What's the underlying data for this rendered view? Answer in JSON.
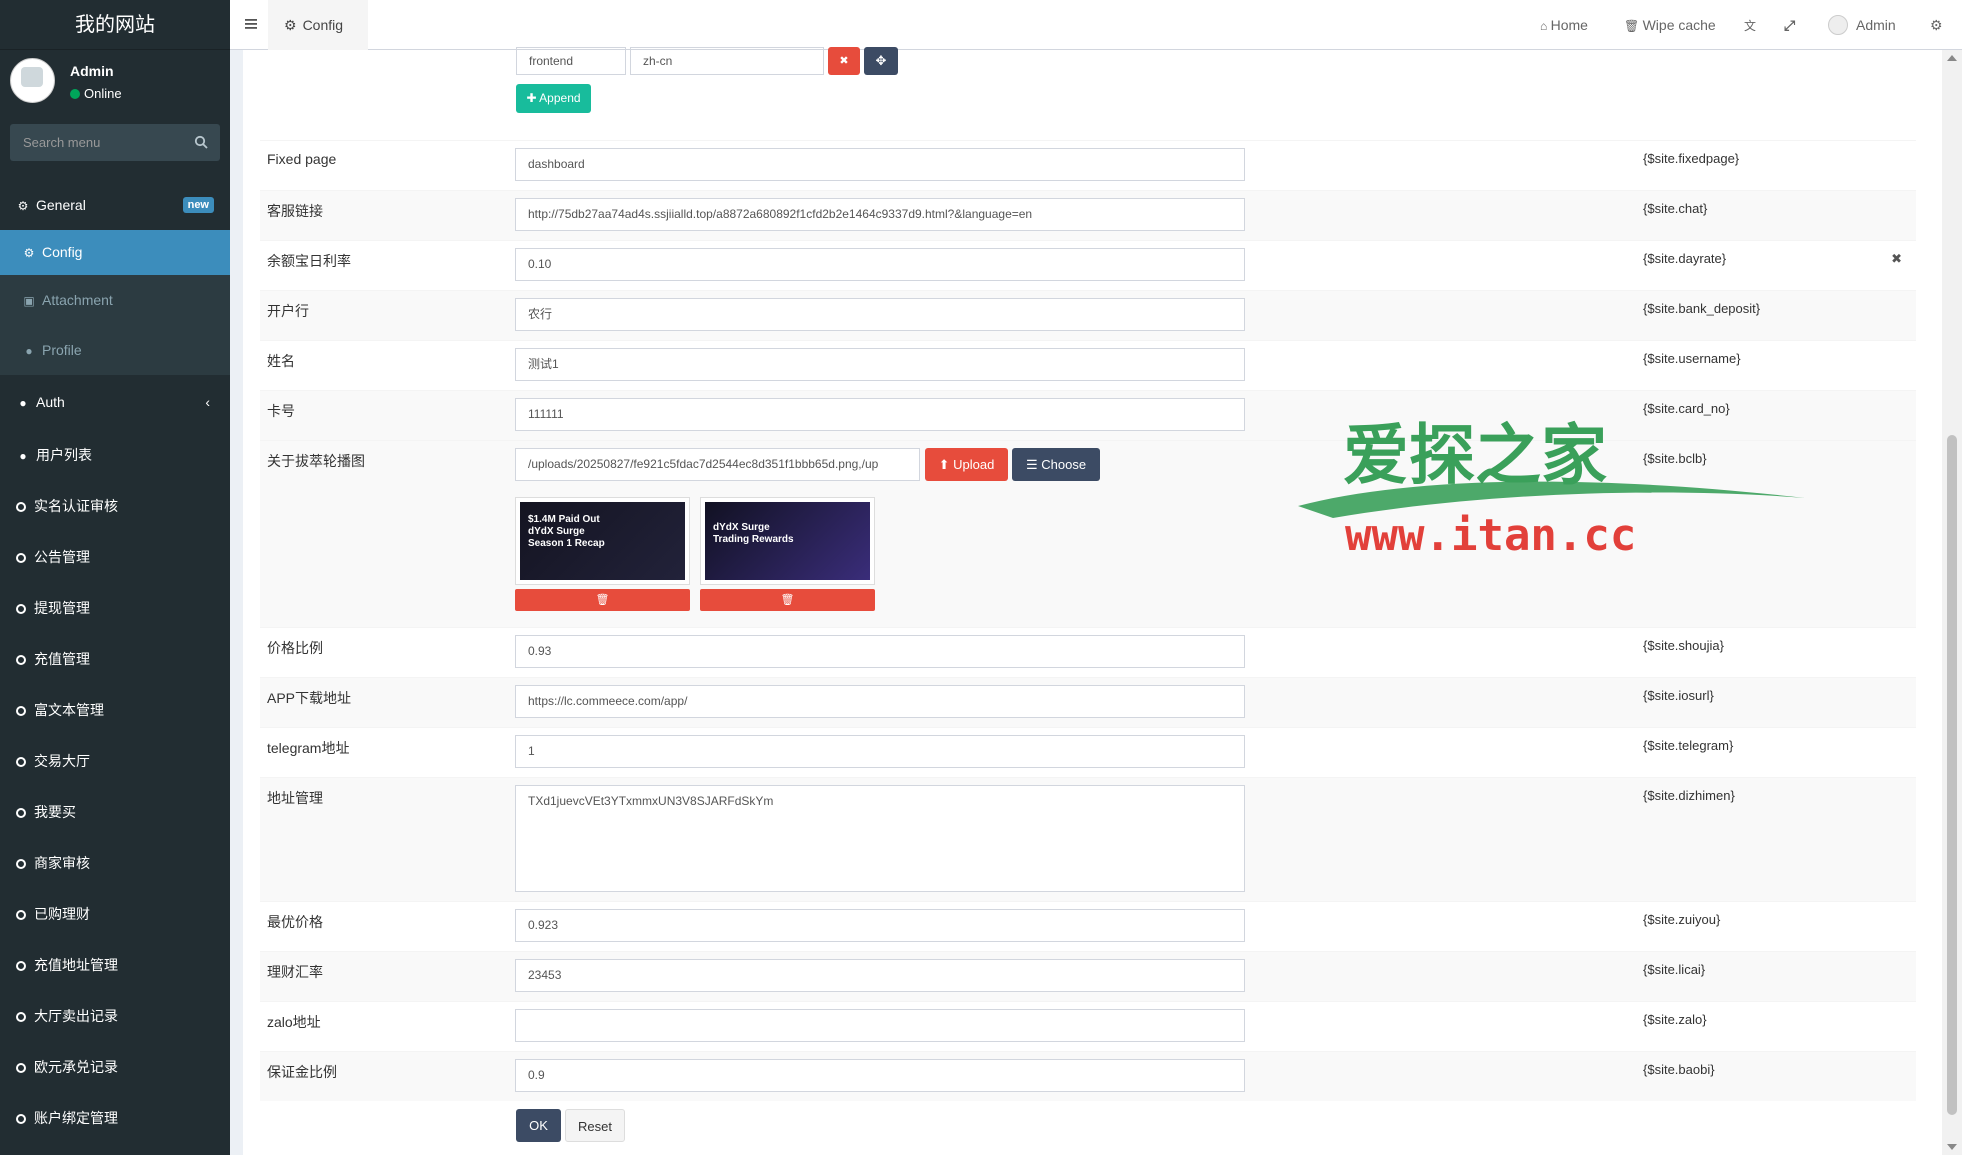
{
  "brand": {
    "title": "我的网站"
  },
  "user": {
    "name": "Admin",
    "status": "Online"
  },
  "search": {
    "placeholder": "Search menu"
  },
  "menu": {
    "general": {
      "label": "General",
      "badge": "new"
    },
    "config": {
      "label": "Config"
    },
    "attachment": {
      "label": "Attachment"
    },
    "profile": {
      "label": "Profile"
    },
    "auth": {
      "label": "Auth"
    },
    "items": [
      "用户列表",
      "实名认证审核",
      "公告管理",
      "提现管理",
      "充值管理",
      "富文本管理",
      "交易大厅",
      "我要买",
      "商家审核",
      "已购理财",
      "充值地址管理",
      "大厅卖出记录",
      "欧元承兑记录",
      "账户绑定管理"
    ]
  },
  "topbar": {
    "tab": "Config",
    "home": "Home",
    "wipe_cache": "Wipe cache",
    "admin": "Admin"
  },
  "lang_row": {
    "key": "frontend",
    "value": "zh-cn",
    "append": "Append"
  },
  "fields": [
    {
      "label": "Fixed page",
      "value": "dashboard",
      "var": "{$site.fixedpage}"
    },
    {
      "label": "客服链接",
      "value": "http://75db27aa74ad4s.ssjiialld.top/a8872a680892f1cfd2b2e1464c9337d9.html?&language=en",
      "var": "{$site.chat}"
    },
    {
      "label": "余额宝日利率",
      "value": "0.10",
      "var": "{$site.dayrate}"
    },
    {
      "label": "开户行",
      "value": "农行",
      "var": "{$site.bank_deposit}"
    },
    {
      "label": "姓名",
      "value": "测试1",
      "var": "{$site.username}"
    },
    {
      "label": "卡号",
      "value": "111111",
      "var": "{$site.card_no}"
    }
  ],
  "banner": {
    "label": "关于拔萃轮播图",
    "value": "/uploads/20250827/fe921c5fdac7d2544ec8d351f1bbb65d.png,/up",
    "var": "{$site.bclb}",
    "upload": "Upload",
    "choose": "Choose",
    "images": [
      {
        "line1": "$1.4M Paid Out",
        "line2": "dYdX Surge",
        "line3": "Season 1 Recap"
      },
      {
        "line1": "dYdX Surge",
        "line2": "Trading Rewards",
        "line3": ""
      }
    ]
  },
  "fields2": [
    {
      "label": "价格比例",
      "value": "0.93",
      "var": "{$site.shoujia}"
    },
    {
      "label": "APP下载地址",
      "value": "https://lc.commeece.com/app/",
      "var": "{$site.iosurl}"
    },
    {
      "label": "telegram地址",
      "value": "1",
      "var": "{$site.telegram}"
    }
  ],
  "address": {
    "label": "地址管理",
    "value": "TXd1juevcVEt3YTxmmxUN3V8SJARFdSkYm",
    "var": "{$site.dizhimen}"
  },
  "fields3": [
    {
      "label": "最优价格",
      "value": "0.923",
      "var": "{$site.zuiyou}"
    },
    {
      "label": "理财汇率",
      "value": "23453",
      "var": "{$site.licai}"
    },
    {
      "label": "zalo地址",
      "value": "",
      "var": "{$site.zalo}"
    },
    {
      "label": "保证金比例",
      "value": "0.9",
      "var": "{$site.baobi}"
    }
  ],
  "actions": {
    "ok": "OK",
    "reset": "Reset"
  },
  "watermark": {
    "top": "爱探之家",
    "bottom": "www.itan.cc"
  },
  "colors": {
    "sidebar": "#222d32",
    "active": "#3c8dbc",
    "danger": "#e74c3c",
    "navy": "#3c4b64",
    "success": "#18bc9c"
  }
}
